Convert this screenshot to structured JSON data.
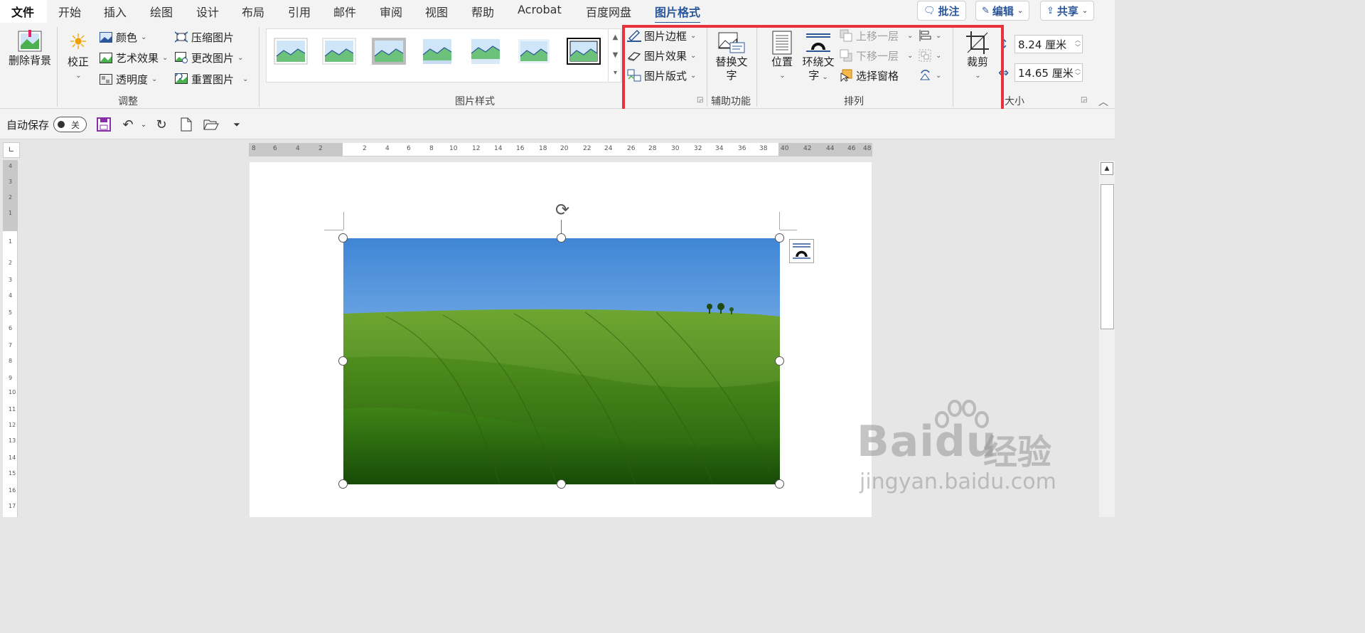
{
  "tabs": [
    {
      "label": "文件",
      "left": 0
    },
    {
      "label": "开始"
    },
    {
      "label": "插入"
    },
    {
      "label": "绘图"
    },
    {
      "label": "设计"
    },
    {
      "label": "布局"
    },
    {
      "label": "引用"
    },
    {
      "label": "邮件"
    },
    {
      "label": "审阅"
    },
    {
      "label": "视图"
    },
    {
      "label": "帮助"
    },
    {
      "label": "Acrobat"
    },
    {
      "label": "百度网盘"
    },
    {
      "label": "图片格式"
    }
  ],
  "right_buttons": {
    "comment": "批注",
    "edit": "编辑",
    "share": "共享"
  },
  "adjust": {
    "remove_bg": "删除背景",
    "correct": "校正",
    "color": "颜色",
    "artistic": "艺术效果",
    "transparency": "透明度",
    "compress": "压缩图片",
    "change": "更改图片",
    "reset": "重置图片",
    "group_label": "调整"
  },
  "picture_styles": {
    "group_label": "图片样式"
  },
  "picture_format": {
    "border": "图片边框",
    "effects": "图片效果",
    "layout": "图片版式"
  },
  "accessibility": {
    "alt_text": "替换文字",
    "group_label": "辅助功能"
  },
  "arrange": {
    "position": "位置",
    "wrap_line1": "环绕文",
    "wrap_line2": "字",
    "bring_forward": "上移一层",
    "send_backward": "下移一层",
    "selection_pane": "选择窗格",
    "group_label": "排列"
  },
  "size": {
    "crop": "裁剪",
    "height": "8.24 厘米",
    "width": "14.65 厘米",
    "group_label": "大小"
  },
  "qat": {
    "autosave_label": "自动保存",
    "autosave_state": "关"
  },
  "watermark": {
    "brand": "Bai",
    "brand_du": "du",
    "cn": "经验",
    "url": "jingyan.baidu.com"
  },
  "colors": {
    "accent": "#2b579a",
    "highlight": "#e8333b"
  }
}
